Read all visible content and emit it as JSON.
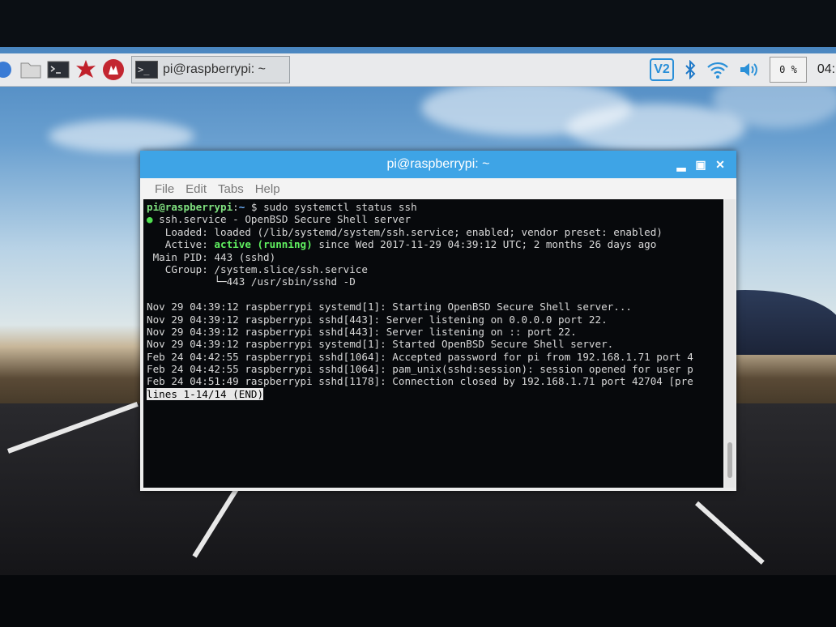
{
  "taskbar": {
    "task_title": "pi@raspberrypi: ~",
    "cpu_label": "0 %",
    "clock": "04:"
  },
  "window": {
    "title": "pi@raspberrypi: ~",
    "menu": [
      "File",
      "Edit",
      "Tabs",
      "Help"
    ]
  },
  "terminal": {
    "prompt_user": "pi@raspberrypi",
    "prompt_sep": ":",
    "prompt_path": "~",
    "prompt_symbol": " $ ",
    "command": "sudo systemctl status ssh",
    "service_line": " ssh.service - OpenBSD Secure Shell server",
    "loaded_line": "   Loaded: loaded (/lib/systemd/system/ssh.service; enabled; vendor preset: enabled)",
    "active_label": "   Active: ",
    "active_state": "active (running)",
    "active_rest": " since Wed 2017-11-29 04:39:12 UTC; 2 months 26 days ago",
    "mainpid_line": " Main PID: 443 (sshd)",
    "cgroup_line": "   CGroup: /system.slice/ssh.service",
    "cgroup_child": "           └─443 /usr/sbin/sshd -D",
    "logs": [
      "Nov 29 04:39:12 raspberrypi systemd[1]: Starting OpenBSD Secure Shell server...",
      "Nov 29 04:39:12 raspberrypi sshd[443]: Server listening on 0.0.0.0 port 22.",
      "Nov 29 04:39:12 raspberrypi sshd[443]: Server listening on :: port 22.",
      "Nov 29 04:39:12 raspberrypi systemd[1]: Started OpenBSD Secure Shell server.",
      "Feb 24 04:42:55 raspberrypi sshd[1064]: Accepted password for pi from 192.168.1.71 port 4",
      "Feb 24 04:42:55 raspberrypi sshd[1064]: pam_unix(sshd:session): session opened for user p",
      "Feb 24 04:51:49 raspberrypi sshd[1178]: Connection closed by 192.168.1.71 port 42704 [pre"
    ],
    "pager_status": "lines 1-14/14 (END)"
  },
  "colors": {
    "titlebar": "#3ea4e6",
    "terminal_bg": "#07090c",
    "prompt_green": "#7fe07f",
    "prompt_blue": "#6fb3ff"
  }
}
